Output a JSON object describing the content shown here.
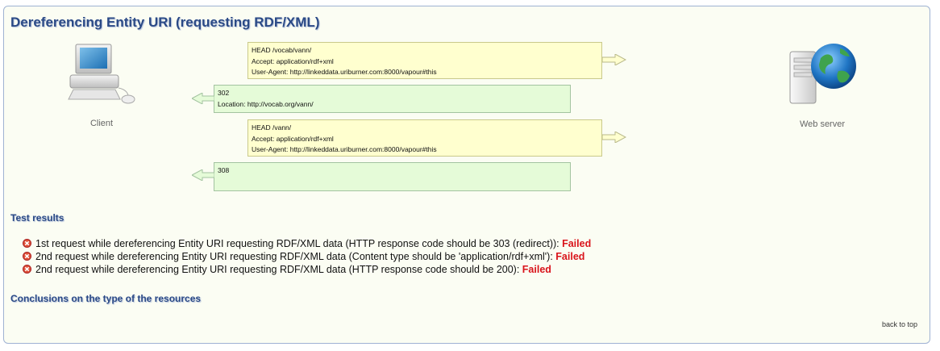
{
  "section": {
    "title": "Dereferencing Entity URI (requesting RDF/XML)"
  },
  "actors": {
    "client_label": "Client",
    "server_label": "Web server"
  },
  "messages": [
    {
      "kind": "request",
      "lines": [
        "HEAD /vocab/vann/",
        "Accept: application/rdf+xml",
        "User-Agent: http://linkeddata.uriburner.com:8000/vapour#this"
      ]
    },
    {
      "kind": "response",
      "lines": [
        "302",
        "Location: http://vocab.org/vann/"
      ]
    },
    {
      "kind": "request",
      "lines": [
        "HEAD /vann/",
        "Accept: application/rdf+xml",
        "User-Agent: http://linkeddata.uriburner.com:8000/vapour#this"
      ]
    },
    {
      "kind": "response",
      "lines": [
        "308"
      ]
    }
  ],
  "test_results": {
    "heading": "Test results",
    "items": [
      {
        "text": "1st request while dereferencing Entity URI requesting RDF/XML data (HTTP response code should be 303 (redirect)):",
        "status": "Failed",
        "icon": "fail-icon"
      },
      {
        "text": "2nd request while dereferencing Entity URI requesting RDF/XML data (Content type should be 'application/rdf+xml'):",
        "status": "Failed",
        "icon": "fail-icon"
      },
      {
        "text": "2nd request while dereferencing Entity URI requesting RDF/XML data (HTTP response code should be 200):",
        "status": "Failed",
        "icon": "fail-icon"
      }
    ]
  },
  "conclusions": {
    "heading": "Conclusions on the type of the resources"
  },
  "footer": {
    "back_to_top": "back to top"
  },
  "colors": {
    "heading": "#2b4a86",
    "failed": "#d9141b",
    "request_bg": "#ffffcf",
    "response_bg": "#e5fbd8"
  }
}
